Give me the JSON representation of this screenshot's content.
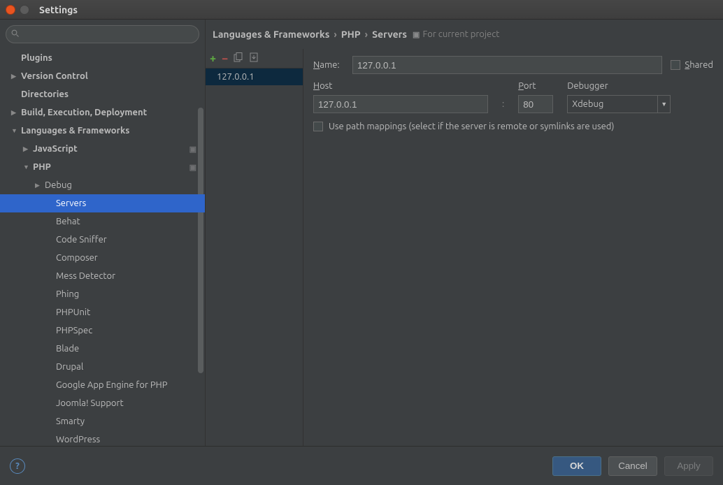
{
  "window": {
    "title": "Settings"
  },
  "search": {
    "placeholder": ""
  },
  "sidebar": {
    "items": [
      {
        "label": "Plugins",
        "level": 1,
        "arrow": ""
      },
      {
        "label": "Version Control",
        "level": 1,
        "arrow": "▶"
      },
      {
        "label": "Directories",
        "level": 1,
        "arrow": ""
      },
      {
        "label": "Build, Execution, Deployment",
        "level": 1,
        "arrow": "▶"
      },
      {
        "label": "Languages & Frameworks",
        "level": 1,
        "arrow": "▼"
      },
      {
        "label": "JavaScript",
        "level": 2,
        "arrow": "▶",
        "proj": true
      },
      {
        "label": "PHP",
        "level": 2,
        "arrow": "▼",
        "proj": true
      },
      {
        "label": "Debug",
        "level": 3,
        "arrow": "▶"
      },
      {
        "label": "Servers",
        "level": 4,
        "arrow": "",
        "selected": true
      },
      {
        "label": "Behat",
        "level": 4,
        "arrow": ""
      },
      {
        "label": "Code Sniffer",
        "level": 4,
        "arrow": ""
      },
      {
        "label": "Composer",
        "level": 4,
        "arrow": ""
      },
      {
        "label": "Mess Detector",
        "level": 4,
        "arrow": ""
      },
      {
        "label": "Phing",
        "level": 4,
        "arrow": ""
      },
      {
        "label": "PHPUnit",
        "level": 4,
        "arrow": ""
      },
      {
        "label": "PHPSpec",
        "level": 4,
        "arrow": ""
      },
      {
        "label": "Blade",
        "level": 4,
        "arrow": ""
      },
      {
        "label": "Drupal",
        "level": 4,
        "arrow": ""
      },
      {
        "label": "Google App Engine for PHP",
        "level": 4,
        "arrow": ""
      },
      {
        "label": "Joomla! Support",
        "level": 4,
        "arrow": ""
      },
      {
        "label": "Smarty",
        "level": 4,
        "arrow": ""
      },
      {
        "label": "WordPress",
        "level": 4,
        "arrow": ""
      }
    ]
  },
  "breadcrumb": {
    "part1": "Languages & Frameworks",
    "part2": "PHP",
    "part3": "Servers",
    "scope": "For current project"
  },
  "servers": {
    "items": [
      {
        "name": "127.0.0.1"
      }
    ]
  },
  "form": {
    "name_label": "Name:",
    "name_value": "127.0.0.1",
    "shared_label": "Shared",
    "host_label": "Host",
    "host_value": "127.0.0.1",
    "port_label": "Port",
    "port_value": "80",
    "debugger_label": "Debugger",
    "debugger_value": "Xdebug",
    "mapping_label": "Use path mappings (select if the server is remote or symlinks are used)"
  },
  "footer": {
    "ok": "OK",
    "cancel": "Cancel",
    "apply": "Apply"
  }
}
